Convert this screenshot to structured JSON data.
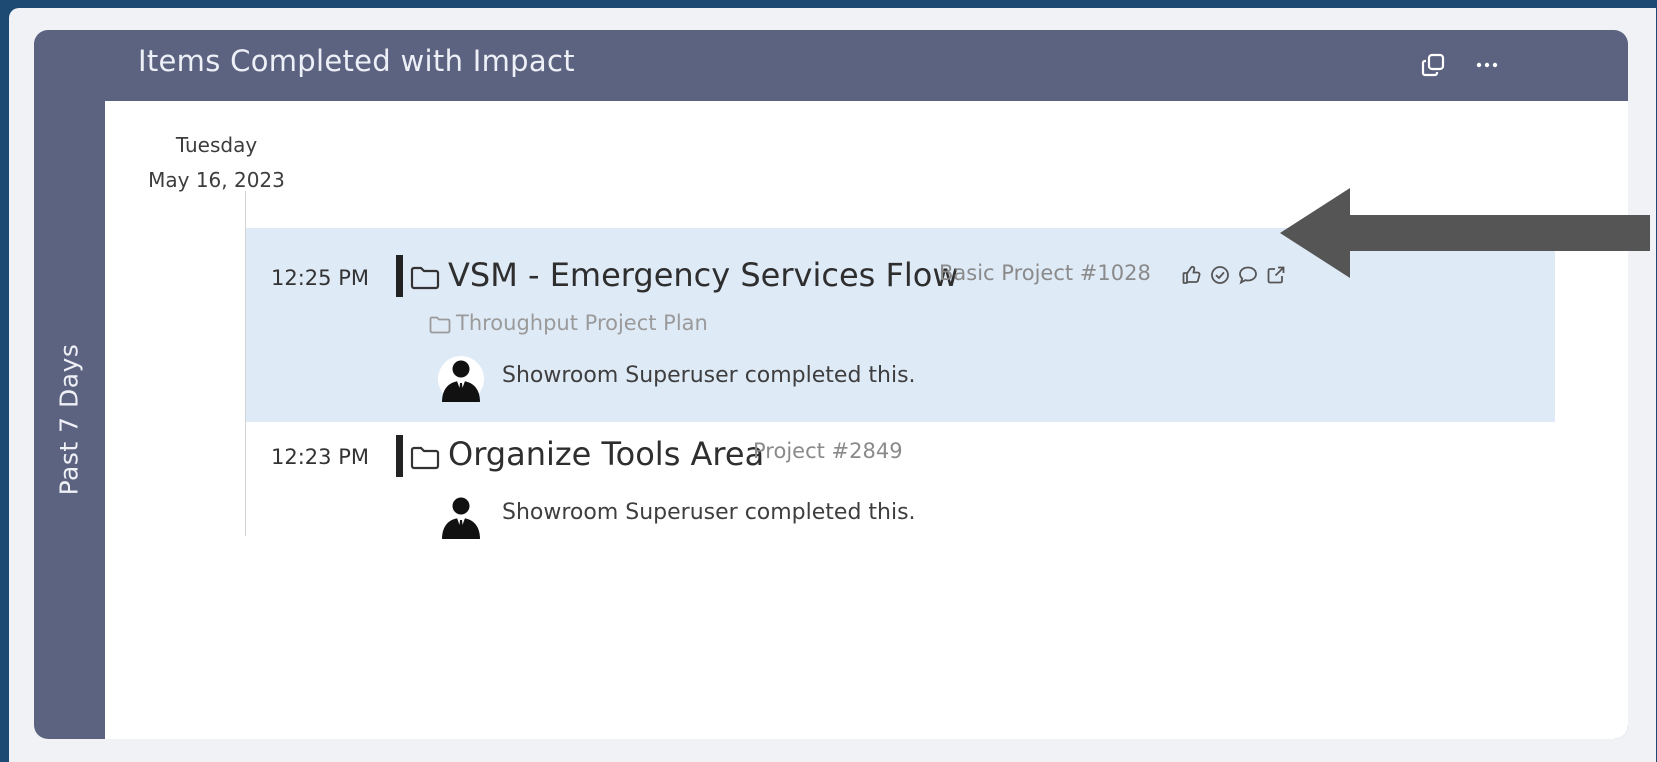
{
  "widget": {
    "title": "Items Completed with Impact",
    "period_label": "Past 7 Days",
    "header_icons": [
      "popout-icon",
      "more-icon"
    ]
  },
  "date_group": {
    "weekday": "Tuesday",
    "date": "May 16, 2023"
  },
  "entries": [
    {
      "time": "12:25 PM",
      "title": "VSM - Emergency Services Flow",
      "type_label": "Basic Project #1028",
      "parent": "Throughput Project Plan",
      "completed_text": "Showroom Superuser completed this.",
      "actions": [
        "thumbs-up-icon",
        "check-circle-icon",
        "comment-icon",
        "external-link-icon"
      ],
      "highlighted": true
    },
    {
      "time": "12:23 PM",
      "title": "Organize Tools Area",
      "type_label": "Project #2849",
      "completed_text": "Showroom Superuser completed this.",
      "highlighted": false
    }
  ],
  "colors": {
    "background": "#1c4a72",
    "header": "#5c6381",
    "highlight_row": "#dfeaf7",
    "annotation_arrow": "#555555"
  }
}
